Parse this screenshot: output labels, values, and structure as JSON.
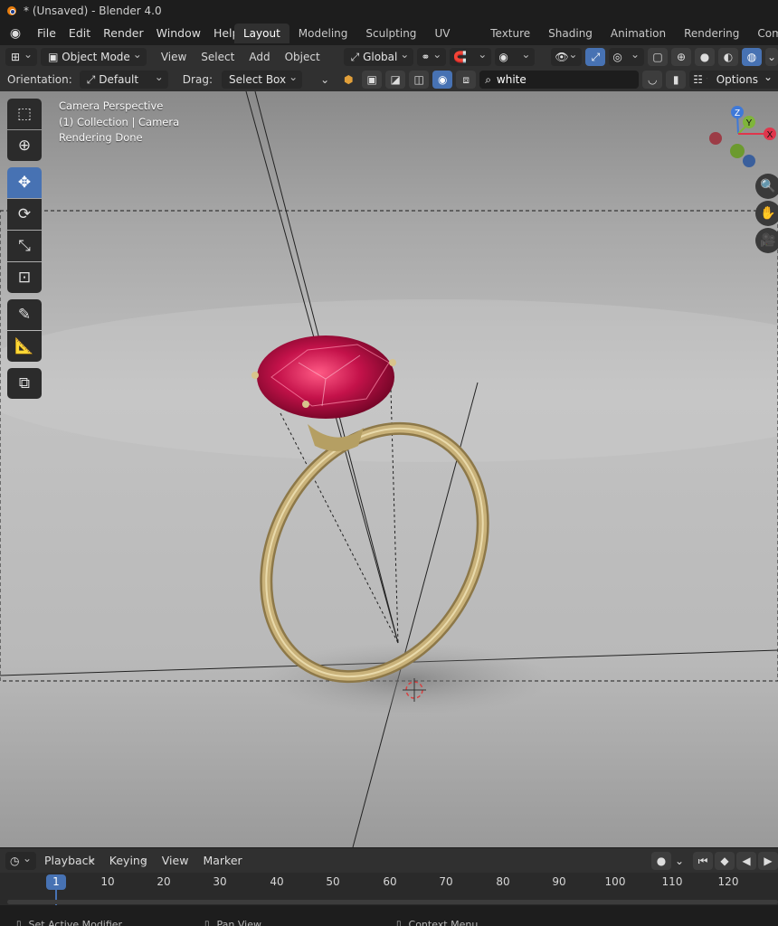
{
  "window": {
    "title": "* (Unsaved) - Blender 4.0"
  },
  "menus": [
    "File",
    "Edit",
    "Render",
    "Window",
    "Help"
  ],
  "workspaces": [
    "Layout",
    "Modeling",
    "Sculpting",
    "UV Editing",
    "Texture Paint",
    "Shading",
    "Animation",
    "Rendering",
    "Comp"
  ],
  "active_workspace": "Layout",
  "header": {
    "mode": "Object Mode",
    "menus": [
      "View",
      "Select",
      "Add",
      "Object"
    ],
    "transform_orientation": "Global"
  },
  "tool_settings": {
    "orientation_label": "Orientation:",
    "orientation_value": "Default",
    "drag_label": "Drag:",
    "drag_value": "Select Box",
    "search_value": "white",
    "options_label": "Options"
  },
  "viewport": {
    "info_lines": [
      "Camera Perspective",
      "(1) Collection | Camera",
      "Rendering Done"
    ],
    "gizmo_axes": [
      "Z",
      "Y",
      "X"
    ]
  },
  "toolbar_tools": [
    {
      "name": "select-box",
      "icon": "select-box-icon"
    },
    {
      "name": "cursor",
      "icon": "cursor-icon"
    },
    {
      "name": "move",
      "icon": "move-icon",
      "active": true
    },
    {
      "name": "rotate",
      "icon": "rotate-icon"
    },
    {
      "name": "scale",
      "icon": "scale-icon"
    },
    {
      "name": "transform",
      "icon": "transform-icon"
    },
    {
      "name": "annotate",
      "icon": "annotate-icon"
    },
    {
      "name": "measure",
      "icon": "measure-icon"
    },
    {
      "name": "add-cube",
      "icon": "add-cube-icon"
    }
  ],
  "timeline": {
    "menus": [
      "Playback",
      "Keying",
      "View",
      "Marker"
    ],
    "current_frame": "1",
    "tick_labels": [
      "10",
      "20",
      "30",
      "40",
      "50",
      "60",
      "70",
      "80",
      "90",
      "100",
      "110",
      "120"
    ]
  },
  "status": {
    "items": [
      "Set Active Modifier",
      "Pan View",
      "Context Menu"
    ]
  },
  "colors": {
    "accent": "#4772b3",
    "gem": "#c4124a",
    "gold": "#c9b27a",
    "axis_x": "#e0364c",
    "axis_y": "#7fb53a",
    "axis_z": "#3f79d8"
  }
}
